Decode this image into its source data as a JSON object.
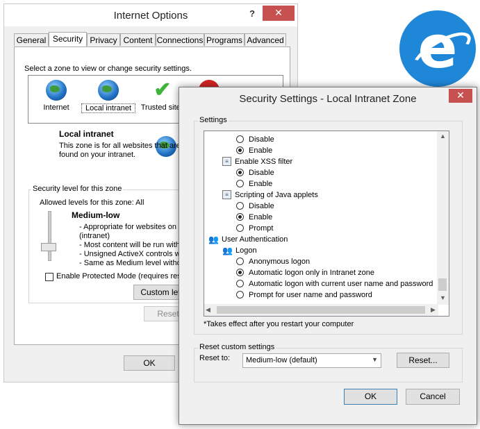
{
  "internet_options": {
    "title": "Internet Options",
    "help": "?",
    "close": "✕",
    "tabs": [
      "General",
      "Security",
      "Privacy",
      "Content",
      "Connections",
      "Programs",
      "Advanced"
    ],
    "zone_prompt": "Select a zone to view or change security settings.",
    "zones": [
      "Internet",
      "Local intranet",
      "Trusted sites"
    ],
    "zone_title": "Local intranet",
    "zone_desc_1": "This zone is for all websites that are",
    "zone_desc_2": "found on your intranet.",
    "level_group": "Security level for this zone",
    "allowed_levels": "Allowed levels for this zone: All",
    "level_name": "Medium-low",
    "level_bullets": [
      "- Appropriate for websites on y",
      "(intranet)",
      "- Most content will be run witho",
      "- Unsigned ActiveX controls will",
      "- Same as Medium level without"
    ],
    "protected_mode": "Enable Protected Mode (requires resta",
    "custom_level": "Custom level",
    "reset_all": "Reset a",
    "ok": "OK"
  },
  "security_settings": {
    "title": "Security Settings - Local Intranet Zone",
    "close": "✕",
    "settings_label": "Settings",
    "items": [
      {
        "type": "radio",
        "label": "Disable",
        "selected": false,
        "indent": 1
      },
      {
        "type": "radio",
        "label": "Enable",
        "selected": true,
        "indent": 1
      },
      {
        "type": "setting",
        "label": "Enable XSS filter",
        "indent": 0
      },
      {
        "type": "radio",
        "label": "Disable",
        "selected": true,
        "indent": 1
      },
      {
        "type": "radio",
        "label": "Enable",
        "selected": false,
        "indent": 1
      },
      {
        "type": "setting",
        "label": "Scripting of Java applets",
        "indent": 0
      },
      {
        "type": "radio",
        "label": "Disable",
        "selected": false,
        "indent": 1
      },
      {
        "type": "radio",
        "label": "Enable",
        "selected": true,
        "indent": 1
      },
      {
        "type": "radio",
        "label": "Prompt",
        "selected": false,
        "indent": 1
      },
      {
        "type": "group",
        "label": "User Authentication",
        "indent": -1
      },
      {
        "type": "group",
        "label": "Logon",
        "indent": 0
      },
      {
        "type": "radio",
        "label": "Anonymous logon",
        "selected": false,
        "indent": 1
      },
      {
        "type": "radio",
        "label": "Automatic logon only in Intranet zone",
        "selected": true,
        "indent": 1
      },
      {
        "type": "radio",
        "label": "Automatic logon with current user name and password",
        "selected": false,
        "indent": 1
      },
      {
        "type": "radio",
        "label": "Prompt for user name and password",
        "selected": false,
        "indent": 1
      }
    ],
    "restart_note": "*Takes effect after you restart your computer",
    "reset_group": "Reset custom settings",
    "reset_to": "Reset to:",
    "reset_value": "Medium-low (default)",
    "reset_button": "Reset...",
    "ok": "OK",
    "cancel": "Cancel"
  },
  "colors": {
    "ie_blue": "#1f87d8",
    "close_red": "#c75050"
  }
}
